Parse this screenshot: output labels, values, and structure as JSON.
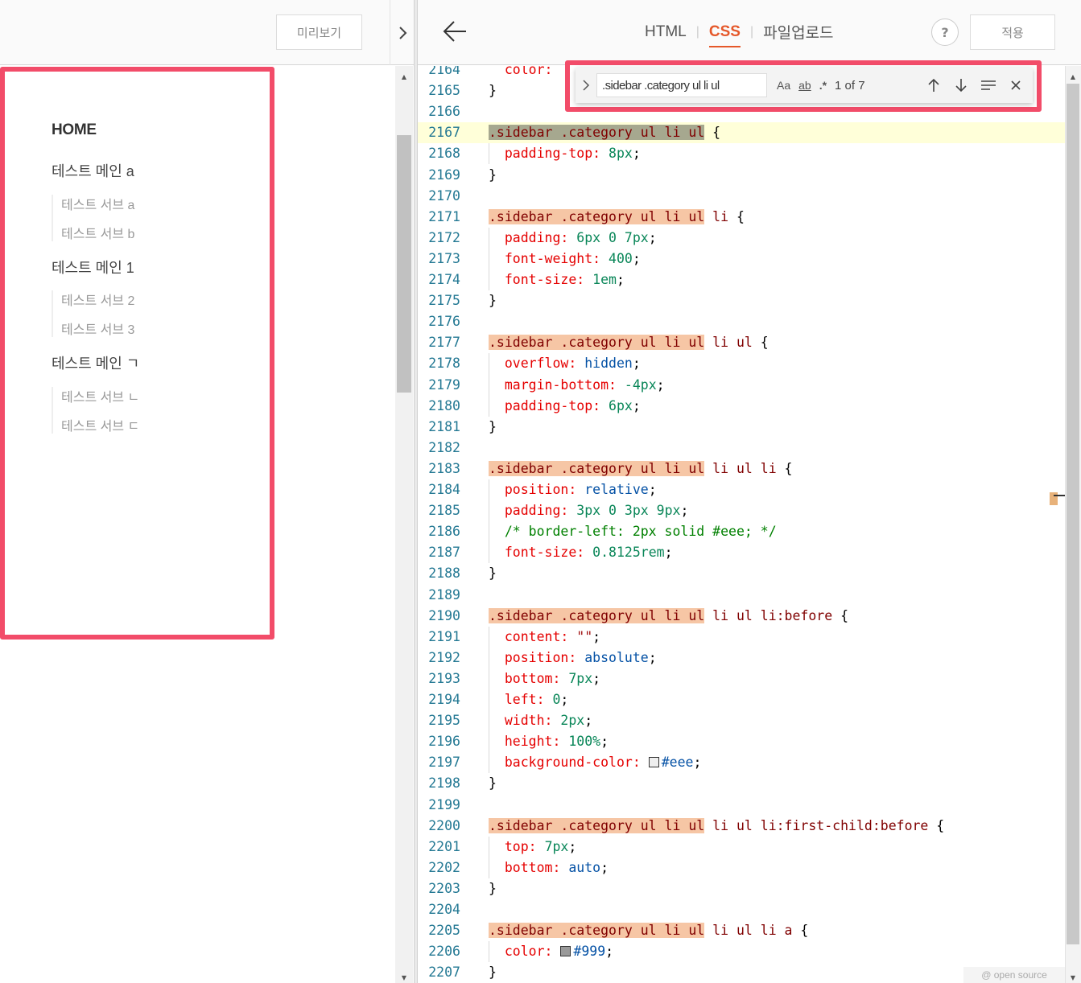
{
  "left": {
    "preview_label": "미리보기",
    "sidebar": {
      "home": "HOME",
      "groups": [
        {
          "main": "테스트 메인 a",
          "subs": [
            "테스트 서브 a",
            "테스트 서브 b"
          ]
        },
        {
          "main": "테스트 메인 1",
          "subs": [
            "테스트 서브 2",
            "테스트 서브 3"
          ]
        },
        {
          "main": "테스트 메인 ㄱ",
          "subs": [
            "테스트 서브 ㄴ",
            "테스트 서브 ㄷ"
          ]
        }
      ]
    }
  },
  "header": {
    "tabs": [
      "HTML",
      "CSS",
      "파일업로드"
    ],
    "active_tab": "CSS",
    "help_label": "?",
    "apply_label": "적용"
  },
  "find": {
    "query": ".sidebar .category ul li ul",
    "opt_case": "Aa",
    "opt_word": "ab",
    "opt_regex": ".*",
    "count": "1 of 7"
  },
  "editor": {
    "lines": [
      {
        "n": "2164",
        "html": "  <span class=\"prop\">color:</span>"
      },
      {
        "n": "2165",
        "html": "}"
      },
      {
        "n": "2166",
        "html": ""
      },
      {
        "n": "2167",
        "html": "<span class=\"sel mc\">.sidebar .category ul li ul</span> {",
        "current": true
      },
      {
        "n": "2168",
        "html": "  <span class=\"prop\">padding-top:</span> <span class=\"num\">8px</span>;"
      },
      {
        "n": "2169",
        "html": "}"
      },
      {
        "n": "2170",
        "html": ""
      },
      {
        "n": "2171",
        "html": "<span class=\"sel m\">.sidebar .category ul li ul</span><span class=\"sel\"> li</span> {"
      },
      {
        "n": "2172",
        "html": "  <span class=\"prop\">padding:</span> <span class=\"num\">6px 0 7px</span>;"
      },
      {
        "n": "2173",
        "html": "  <span class=\"prop\">font-weight:</span> <span class=\"num\">400</span>;"
      },
      {
        "n": "2174",
        "html": "  <span class=\"prop\">font-size:</span> <span class=\"num\">1em</span>;"
      },
      {
        "n": "2175",
        "html": "}"
      },
      {
        "n": "2176",
        "html": ""
      },
      {
        "n": "2177",
        "html": "<span class=\"sel m\">.sidebar .category ul li ul</span><span class=\"sel\"> li ul</span> {"
      },
      {
        "n": "2178",
        "html": "  <span class=\"prop\">overflow:</span> <span class=\"kw\">hidden</span>;"
      },
      {
        "n": "2179",
        "html": "  <span class=\"prop\">margin-bottom:</span> <span class=\"num\">-4px</span>;"
      },
      {
        "n": "2180",
        "html": "  <span class=\"prop\">padding-top:</span> <span class=\"num\">6px</span>;"
      },
      {
        "n": "2181",
        "html": "}"
      },
      {
        "n": "2182",
        "html": ""
      },
      {
        "n": "2183",
        "html": "<span class=\"sel m\">.sidebar .category ul li ul</span><span class=\"sel\"> li ul li</span> {"
      },
      {
        "n": "2184",
        "html": "  <span class=\"prop\">position:</span> <span class=\"kw\">relative</span>;"
      },
      {
        "n": "2185",
        "html": "  <span class=\"prop\">padding:</span> <span class=\"num\">3px 0 3px 9px</span>;"
      },
      {
        "n": "2186",
        "html": "  <span class=\"cmt\">/* border-left: 2px solid #eee; */</span>"
      },
      {
        "n": "2187",
        "html": "  <span class=\"prop\">font-size:</span> <span class=\"num\">0.8125rem</span>;"
      },
      {
        "n": "2188",
        "html": "}"
      },
      {
        "n": "2189",
        "html": ""
      },
      {
        "n": "2190",
        "html": "<span class=\"sel m\">.sidebar .category ul li ul</span><span class=\"sel\"> li ul li:before</span> {"
      },
      {
        "n": "2191",
        "html": "  <span class=\"prop\">content:</span> <span class=\"str\">\"\"</span>;"
      },
      {
        "n": "2192",
        "html": "  <span class=\"prop\">position:</span> <span class=\"kw\">absolute</span>;"
      },
      {
        "n": "2193",
        "html": "  <span class=\"prop\">bottom:</span> <span class=\"num\">7px</span>;"
      },
      {
        "n": "2194",
        "html": "  <span class=\"prop\">left:</span> <span class=\"num\">0</span>;"
      },
      {
        "n": "2195",
        "html": "  <span class=\"prop\">width:</span> <span class=\"num\">2px</span>;"
      },
      {
        "n": "2196",
        "html": "  <span class=\"prop\">height:</span> <span class=\"num\">100%</span>;"
      },
      {
        "n": "2197",
        "html": "  <span class=\"prop\">background-color:</span> <span class=\"swatch\" style=\"background:#eee\"></span><span class=\"kw\">#eee</span>;"
      },
      {
        "n": "2198",
        "html": "}"
      },
      {
        "n": "2199",
        "html": ""
      },
      {
        "n": "2200",
        "html": "<span class=\"sel m\">.sidebar .category ul li ul</span><span class=\"sel\"> li ul li:first-child:before</span> {"
      },
      {
        "n": "2201",
        "html": "  <span class=\"prop\">top:</span> <span class=\"num\">7px</span>;"
      },
      {
        "n": "2202",
        "html": "  <span class=\"prop\">bottom:</span> <span class=\"kw\">auto</span>;"
      },
      {
        "n": "2203",
        "html": "}"
      },
      {
        "n": "2204",
        "html": ""
      },
      {
        "n": "2205",
        "html": "<span class=\"sel m\">.sidebar .category ul li ul</span><span class=\"sel\"> li ul li a</span> {"
      },
      {
        "n": "2206",
        "html": "  <span class=\"prop\">color:</span> <span class=\"swatch\" style=\"background:#999\"></span><span class=\"kw\">#999</span>;"
      },
      {
        "n": "2207",
        "html": "}"
      }
    ]
  },
  "footer_tag": "@ open source",
  "colors": {
    "accent": "#e5582a",
    "highlight_box": "#f24c69",
    "match_bg": "#f6c6a5",
    "current_match_bg": "#a6a88f"
  },
  "icons": {
    "back": "arrow-left-icon",
    "collapse": "chevron-right-icon",
    "find_toggle": "chevron-right-icon",
    "prev": "arrow-up-icon",
    "next": "arrow-down-icon",
    "selection": "find-in-selection-icon",
    "close": "close-icon"
  }
}
